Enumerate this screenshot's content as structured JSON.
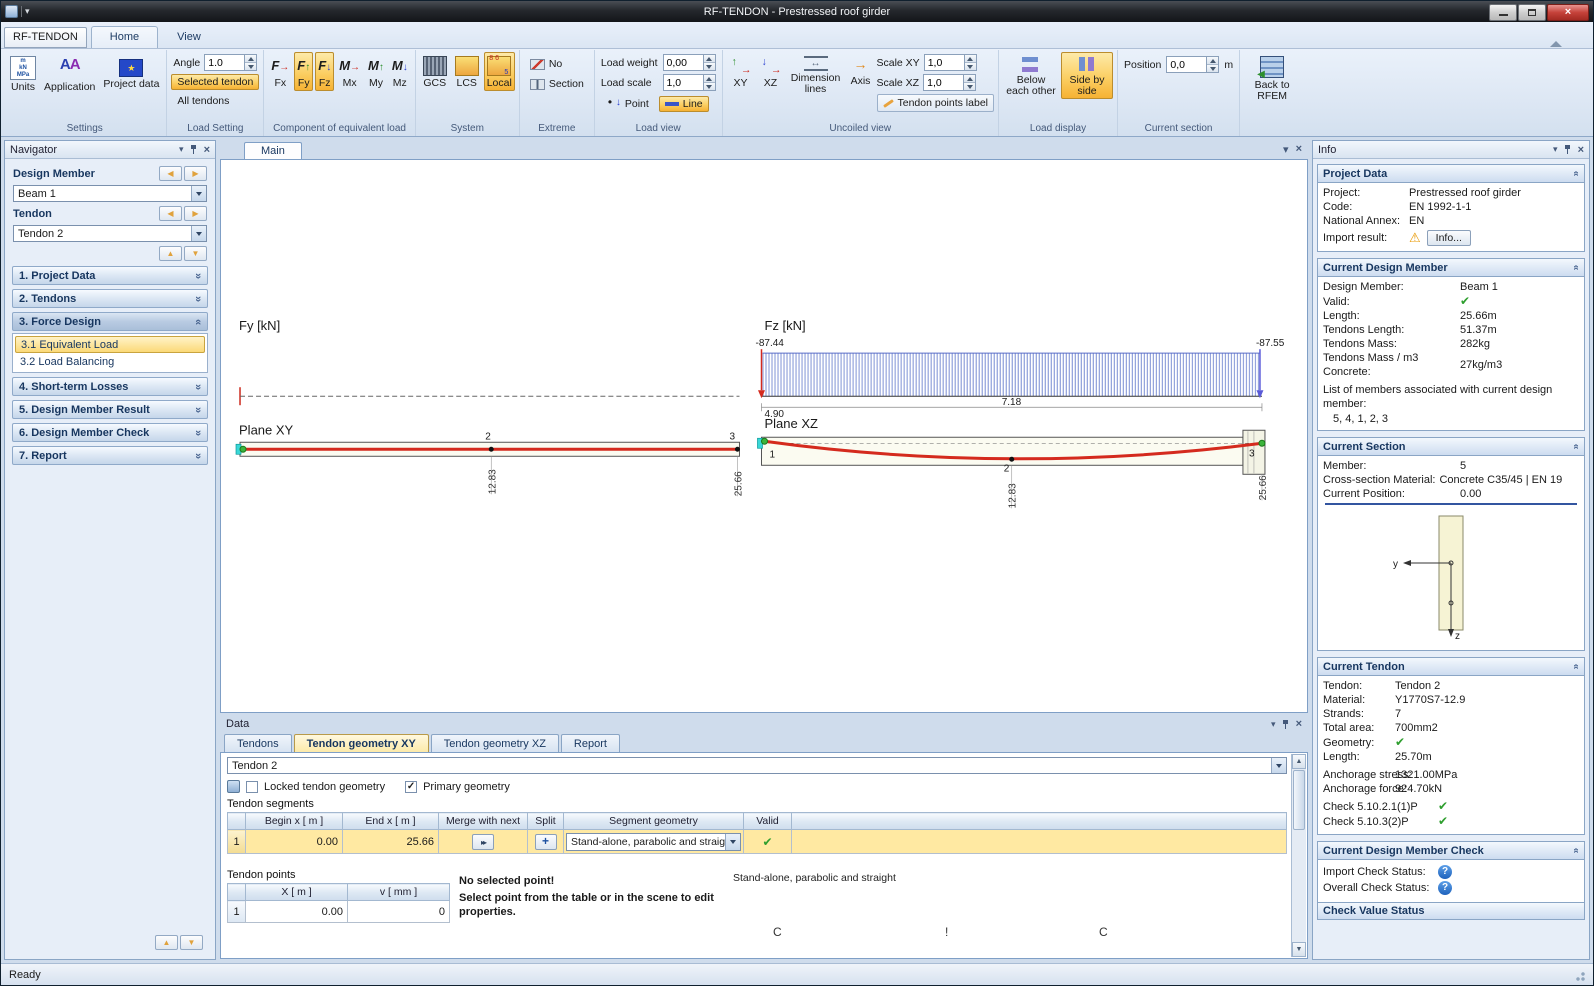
{
  "window": {
    "title": "RF-TENDON - Prestressed roof girder",
    "status": "Ready"
  },
  "colors": {
    "toggle_highlight": "#fbcf63",
    "selected_row": "#ffe9a2",
    "valid_green": "#2e9e2e",
    "warning_amber": "#e89800",
    "info_blue": "#2f7fd6",
    "tendon_red": "#d42a1e",
    "load_blue": "#7b8fd4"
  },
  "ribbon": {
    "app_tab": "RF-TENDON",
    "tabs": {
      "home": "Home",
      "view": "View"
    },
    "settings": {
      "label": "Settings",
      "units": "Units",
      "application": "Application",
      "project_data": "Project data"
    },
    "load_setting": {
      "label": "Load Setting",
      "angle_label": "Angle",
      "angle_value": "1.0",
      "selected_tendon": "Selected tendon",
      "all_tendons": "All tendons"
    },
    "component": {
      "label": "Component of equivalent load",
      "fx": "Fx",
      "fy": "Fy",
      "fz": "Fz",
      "mx": "Mx",
      "my": "My",
      "mz": "Mz"
    },
    "system": {
      "label": "System",
      "gcs": "GCS",
      "lcs": "LCS",
      "local": "Local"
    },
    "extreme": {
      "label": "Extreme",
      "no": "No",
      "section": "Section"
    },
    "load_view": {
      "label": "Load view",
      "load_weight_label": "Load weight",
      "load_weight_value": "0,00",
      "load_scale_label": "Load scale",
      "load_scale_value": "1,0",
      "point": "Point",
      "line": "Line"
    },
    "uncoiled_view": {
      "label": "Uncoiled view",
      "xy": "XY",
      "xz": "XZ",
      "dimension_lines": "Dimension lines",
      "axis": "Axis",
      "scale_xy_label": "Scale XY",
      "scale_xy_value": "1,0",
      "scale_xz_label": "Scale XZ",
      "scale_xz_value": "1,0",
      "tendon_points_label": "Tendon points label"
    },
    "load_display": {
      "label": "Load display",
      "below": "Below each other",
      "side": "Side by side"
    },
    "current_section": {
      "label": "Current section",
      "position_label": "Position",
      "position_value": "0,0",
      "position_unit": "m"
    },
    "back_to_rfem": "Back to RFEM"
  },
  "navigator": {
    "title": "Navigator",
    "design_member_label": "Design Member",
    "design_member_value": "Beam 1",
    "tendon_label": "Tendon",
    "tendon_value": "Tendon 2",
    "item1": "1. Project Data",
    "item2": "2. Tendons",
    "item3": "3. Force Design",
    "item31": "3.1 Equivalent Load",
    "item32": "3.2 Load Balancing",
    "item4": "4. Short-term Losses",
    "item5": "5. Design Member Result",
    "item6": "6. Design Member Check",
    "item7": "7. Report"
  },
  "main_view": {
    "tab": "Main",
    "fy_title": "Fy [kN]",
    "fz_title": "Fz [kN]",
    "plane_xy": "Plane XY",
    "plane_xz": "Plane XZ",
    "fz_left": "-87.44",
    "fz_right": "-87.55",
    "fz_dim_a": "4.90",
    "fz_dim_b": "7.18",
    "xy_mid_dim": "12.83",
    "xy_end_dim": "25.66",
    "xz_mid_dim": "12.83",
    "xz_end_dim": "25.66",
    "xy_pt2": "2",
    "xy_pt3": "3",
    "xz_pt1": "1",
    "xz_pt2": "2",
    "xz_pt3": "3"
  },
  "data_panel": {
    "title": "Data",
    "tabs": [
      "Tendons",
      "Tendon geometry XY",
      "Tendon geometry XZ",
      "Report"
    ],
    "tendon_selector": "Tendon 2",
    "locked_checkbox": "Locked tendon geometry",
    "primary_checkbox": "Primary geometry",
    "segments_label": "Tendon segments",
    "seg_cols": [
      "Begin x  [ m ]",
      "End x  [ m ]",
      "Merge with next",
      "Split",
      "Segment geometry",
      "Valid"
    ],
    "seg_row": {
      "num": "1",
      "begin": "0.00",
      "end": "25.66",
      "geometry": "Stand-alone, parabolic and straight"
    },
    "points_label": "Tendon points",
    "pt_cols": [
      "X  [ m ]",
      "v  [ mm ]"
    ],
    "pt_row": {
      "num": "1",
      "x": "0.00",
      "v": "0"
    },
    "no_selection_title": "No selected point!",
    "no_selection_text": "Select point from the table or in the scene to edit properties.",
    "geometry_caption": "Stand-alone, parabolic and straight",
    "symbols": [
      "C",
      "!",
      "C"
    ]
  },
  "info": {
    "title": "Info",
    "project": {
      "header": "Project Data",
      "rows": [
        {
          "l": "Project:",
          "v": "Prestressed roof girder"
        },
        {
          "l": "Code:",
          "v": "EN 1992-1-1"
        },
        {
          "l": "National Annex:",
          "v": "EN"
        }
      ],
      "import_label": "Import result:",
      "info_button": "Info..."
    },
    "member": {
      "header": "Current Design Member",
      "rows": [
        {
          "l": "Design Member:",
          "v": "Beam 1"
        },
        {
          "l": "Valid:",
          "v": ""
        },
        {
          "l": "Length:",
          "v": "25.66m"
        },
        {
          "l": "Tendons Length:",
          "v": "51.37m"
        },
        {
          "l": "Tendons Mass:",
          "v": "282kg"
        },
        {
          "l": "Tendons Mass / m3 Concrete:",
          "v": "27kg/m3"
        }
      ],
      "assoc_label": "List of members associated with current design member:",
      "assoc_value": "5, 4, 1, 2, 3"
    },
    "section": {
      "header": "Current Section",
      "member_label": "Member:",
      "member_value": "5",
      "material_label": "Cross-section Material:",
      "material_value": "Concrete C35/45 | EN 19",
      "position_label": "Current Position:",
      "position_value": "0.00",
      "axis_y": "y",
      "axis_z": "z"
    },
    "tendon": {
      "header": "Current Tendon",
      "rows": [
        {
          "l": "Tendon:",
          "v": "Tendon 2"
        },
        {
          "l": "Material:",
          "v": "Y1770S7-12.9"
        },
        {
          "l": "Strands:",
          "v": "7"
        },
        {
          "l": "Total area:",
          "v": "700mm2"
        },
        {
          "l": "Geometry:",
          "v": ""
        },
        {
          "l": "Length:",
          "v": "25.70m"
        },
        {
          "l": "Anchorage stress:",
          "v": "1321.00MPa"
        },
        {
          "l": "Anchorage force:",
          "v": "924.70kN"
        },
        {
          "l": "Check 5.10.2.1(1)P",
          "v": ""
        },
        {
          "l": "Check 5.10.3(2)P",
          "v": ""
        }
      ]
    },
    "check": {
      "header": "Current Design Member Check",
      "import_label": "Import Check Status:",
      "overall_label": "Overall Check Status:",
      "value_status": "Check Value Status"
    }
  }
}
